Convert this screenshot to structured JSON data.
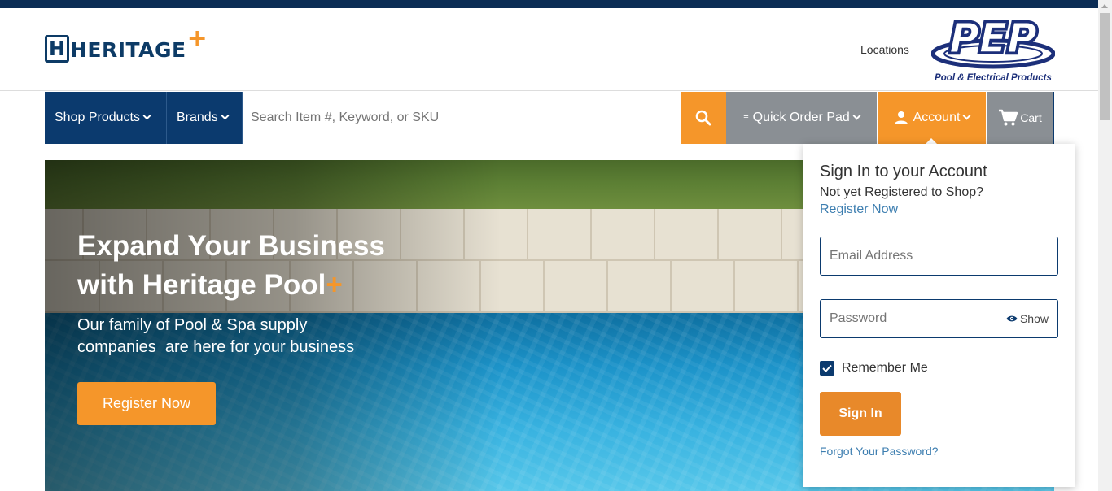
{
  "header": {
    "logo": {
      "h_letter": "H",
      "word": "HERITAGE",
      "plus": "+"
    },
    "locations_label": "Locations",
    "partner_logo": {
      "letters": "PEP",
      "caption": "Pool & Electrical Products"
    }
  },
  "nav": {
    "shop_products": "Shop Products",
    "brands": "Brands",
    "search_placeholder": "Search Item #, Keyword, or SKU",
    "quick_order_pad": "Quick Order Pad",
    "account": "Account",
    "cart": "Cart"
  },
  "hero": {
    "title_line1": "Expand Your Business",
    "title_line2": "with Heritage Pool",
    "title_plus": "+",
    "subtitle_line1": "Our family of Pool & Spa supply",
    "subtitle_line2": "companies  are here for your business",
    "register_button": "Register Now"
  },
  "signin": {
    "title": "Sign In to your Account",
    "not_registered": "Not yet Registered to Shop?",
    "register_link": "Register Now",
    "email_placeholder": "Email Address",
    "password_placeholder": "Password",
    "show_label": "Show",
    "remember_me": "Remember Me",
    "remember_checked": true,
    "sign_in_button": "Sign In",
    "forgot_password": "Forgot Your Password?"
  },
  "colors": {
    "navy": "#0b3a6e",
    "orange": "#f5962a",
    "gray": "#8a8f94",
    "link": "#3d7eb0"
  },
  "icons": {
    "search": "search-icon",
    "quick_order": "list-icon",
    "account": "user-icon",
    "cart": "cart-icon",
    "show_password": "eye-icon",
    "checkbox": "checkmark-icon",
    "chevron": "chevron-down-icon"
  }
}
